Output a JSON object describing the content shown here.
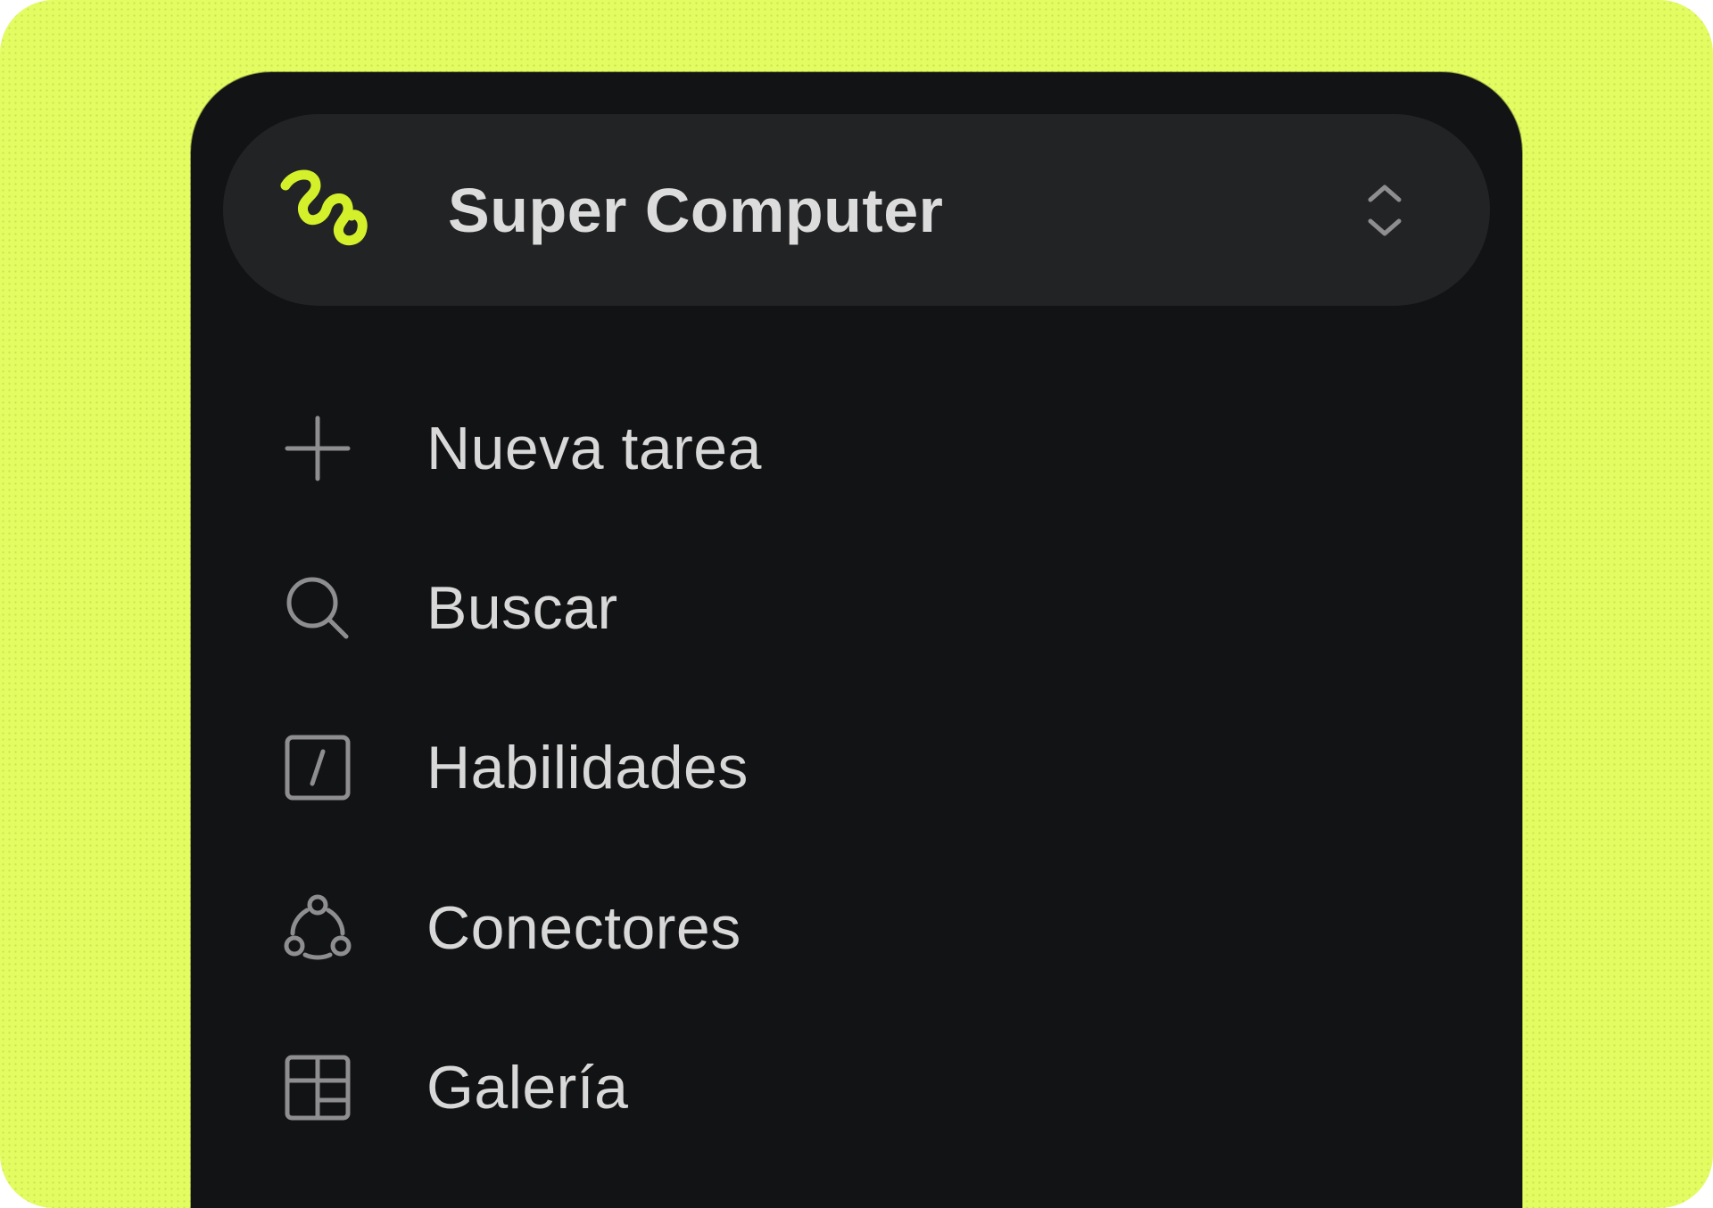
{
  "workspace": {
    "name": "Super Computer",
    "logo_icon": "squiggle-logo-icon",
    "switcher_icon": "chevron-up-down-icon",
    "accent_color": "#d4f02a"
  },
  "nav": {
    "items": [
      {
        "label": "Nueva tarea",
        "icon": "plus-icon"
      },
      {
        "label": "Buscar",
        "icon": "search-icon"
      },
      {
        "label": "Habilidades",
        "icon": "slash-square-icon"
      },
      {
        "label": "Conectores",
        "icon": "connectors-icon"
      },
      {
        "label": "Galería",
        "icon": "gallery-grid-icon"
      }
    ]
  },
  "colors": {
    "background": "#e2fc62",
    "panel": "#121315",
    "switcher": "#222325",
    "text": "#d8d8d8",
    "icon": "#8e8e90"
  }
}
